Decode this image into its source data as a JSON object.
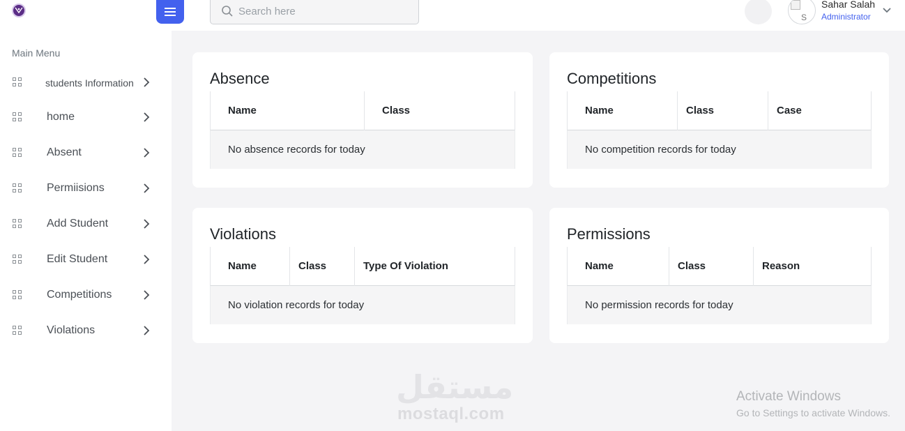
{
  "header": {
    "search_placeholder": "Search here",
    "user": {
      "name": "Sahar Salah",
      "role": "Administrator",
      "avatar_alt": "S"
    }
  },
  "sidebar": {
    "title": "Main Menu",
    "items": [
      {
        "label": "students Information",
        "icon": "grid-icon"
      },
      {
        "label": "home",
        "icon": "grid-icon"
      },
      {
        "label": "Absent",
        "icon": "grid-icon"
      },
      {
        "label": "Permiisions",
        "icon": "grid-icon"
      },
      {
        "label": "Add Student",
        "icon": "grid-icon"
      },
      {
        "label": "Edit Student",
        "icon": "grid-icon"
      },
      {
        "label": "Competitions",
        "icon": "grid-icon"
      },
      {
        "label": "Violations",
        "icon": "grid-icon"
      }
    ]
  },
  "cards": {
    "absence": {
      "title": "Absence",
      "columns": [
        "Name",
        "Class"
      ],
      "empty": "No absence records for today"
    },
    "competitions": {
      "title": "Competitions",
      "columns": [
        "Name",
        "Class",
        "Case"
      ],
      "empty": "No competition records for today"
    },
    "violations": {
      "title": "Violations",
      "columns": [
        "Name",
        "Class",
        "Type Of Violation"
      ],
      "empty": "No violation records for today"
    },
    "permissions": {
      "title": "Permissions",
      "columns": [
        "Name",
        "Class",
        "Reason"
      ],
      "empty": "No permission records for today"
    }
  },
  "watermark": {
    "logo_text": "مستقل",
    "site": "mostaql.com"
  },
  "windows_activation": {
    "title": "Activate Windows",
    "subtitle": "Go to Settings to activate Windows."
  },
  "colors": {
    "accent": "#4361ee",
    "logo": "#5b2d86",
    "background": "#f4f4f6"
  }
}
